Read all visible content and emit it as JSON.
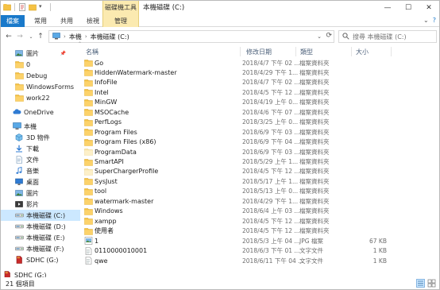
{
  "titlebar": {
    "context_tab": "磁碟機工具",
    "title": "本機磁碟 (C:)",
    "minimize": "—",
    "maximize": "☐",
    "close": "✕"
  },
  "ribbon": {
    "tabs": [
      "檔案",
      "常用",
      "共用",
      "檢視",
      "管理"
    ],
    "collapse": "⌄",
    "help": "?"
  },
  "address": {
    "crumbs": [
      "本機",
      "本機磁碟 (C:)"
    ],
    "search_placeholder": "搜尋 本機磁碟 (C:)"
  },
  "sidebar": {
    "items": [
      {
        "label": "圖片",
        "icon": "pictures-icon"
      },
      {
        "label": "0",
        "icon": "folder-icon"
      },
      {
        "label": "Debug",
        "icon": "folder-icon"
      },
      {
        "label": "WindowsForms",
        "icon": "folder-icon"
      },
      {
        "label": "work22",
        "icon": "folder-icon"
      },
      {
        "label": "OneDrive",
        "icon": "onedrive-icon"
      },
      {
        "label": "本機",
        "icon": "this-pc-icon"
      },
      {
        "label": "3D 物件",
        "icon": "3d-objects-icon"
      },
      {
        "label": "下載",
        "icon": "downloads-icon"
      },
      {
        "label": "文件",
        "icon": "documents-icon"
      },
      {
        "label": "音樂",
        "icon": "music-icon"
      },
      {
        "label": "桌面",
        "icon": "desktop-icon"
      },
      {
        "label": "圖片",
        "icon": "pictures-icon"
      },
      {
        "label": "影片",
        "icon": "videos-icon"
      },
      {
        "label": "本機磁碟 (C:)",
        "icon": "drive-icon"
      },
      {
        "label": "本機磁碟 (D:)",
        "icon": "drive-icon"
      },
      {
        "label": "本機磁碟 (E:)",
        "icon": "drive-icon"
      },
      {
        "label": "本機磁碟 (F:)",
        "icon": "drive-icon"
      },
      {
        "label": "SDHC (G:)",
        "icon": "sd-card-icon"
      },
      {
        "label": "SDHC (G:)",
        "icon": "sd-card-icon"
      }
    ]
  },
  "columns": {
    "name": "名稱",
    "date": "修改日期",
    "type": "類型",
    "size": "大小"
  },
  "files": [
    {
      "name": "Go",
      "date": "2018/4/7 下午 02 ...",
      "type": "檔案資料夾",
      "size": "",
      "kind": "folder"
    },
    {
      "name": "HiddenWatermark-master",
      "date": "2018/4/29 下午 1...",
      "type": "檔案資料夾",
      "size": "",
      "kind": "folder"
    },
    {
      "name": "InfoFile",
      "date": "2018/4/7 下午 02 ...",
      "type": "檔案資料夾",
      "size": "",
      "kind": "folder"
    },
    {
      "name": "Intel",
      "date": "2018/4/5 下午 12 ...",
      "type": "檔案資料夾",
      "size": "",
      "kind": "folder"
    },
    {
      "name": "MinGW",
      "date": "2018/4/19 上午 0...",
      "type": "檔案資料夾",
      "size": "",
      "kind": "folder"
    },
    {
      "name": "MSOCache",
      "date": "2018/4/6 下午 07 ...",
      "type": "檔案資料夾",
      "size": "",
      "kind": "folder"
    },
    {
      "name": "PerfLogs",
      "date": "2018/3/25 上午 0...",
      "type": "檔案資料夾",
      "size": "",
      "kind": "folder"
    },
    {
      "name": "Program Files",
      "date": "2018/6/9 下午 03 ...",
      "type": "檔案資料夾",
      "size": "",
      "kind": "folder"
    },
    {
      "name": "Program Files (x86)",
      "date": "2018/6/9 下午 04 ...",
      "type": "檔案資料夾",
      "size": "",
      "kind": "folder"
    },
    {
      "name": "ProgramData",
      "date": "2018/6/9 下午 03 ...",
      "type": "檔案資料夾",
      "size": "",
      "kind": "folder-light"
    },
    {
      "name": "SmartAPI",
      "date": "2018/5/29 上午 1...",
      "type": "檔案資料夾",
      "size": "",
      "kind": "folder"
    },
    {
      "name": "SuperChargerProfile",
      "date": "2018/4/5 下午 12 ...",
      "type": "檔案資料夾",
      "size": "",
      "kind": "folder-light"
    },
    {
      "name": "SysJust",
      "date": "2018/5/17 上午 1...",
      "type": "檔案資料夾",
      "size": "",
      "kind": "folder"
    },
    {
      "name": "tool",
      "date": "2018/5/13 上午 0...",
      "type": "檔案資料夾",
      "size": "",
      "kind": "folder"
    },
    {
      "name": "watermark-master",
      "date": "2018/4/29 下午 1...",
      "type": "檔案資料夾",
      "size": "",
      "kind": "folder"
    },
    {
      "name": "Windows",
      "date": "2018/6/4 上午 03 ...",
      "type": "檔案資料夾",
      "size": "",
      "kind": "folder"
    },
    {
      "name": "xampp",
      "date": "2018/4/5 下午 12 ...",
      "type": "檔案資料夾",
      "size": "",
      "kind": "folder"
    },
    {
      "name": "使用者",
      "date": "2018/4/5 下午 12 ...",
      "type": "檔案資料夾",
      "size": "",
      "kind": "folder"
    },
    {
      "name": "1",
      "date": "2018/5/3 上午 04 ...",
      "type": "JPG 檔案",
      "size": "67 KB",
      "kind": "image"
    },
    {
      "name": "0110000010001",
      "date": "2018/6/3 下午 01 ...",
      "type": "文字文件",
      "size": "1 KB",
      "kind": "text"
    },
    {
      "name": "qwe",
      "date": "2018/6/11 下午 04 ...",
      "type": "文字文件",
      "size": "1 KB",
      "kind": "text"
    }
  ],
  "status": {
    "count": "21 個項目"
  },
  "colors": {
    "accent": "#1979ca",
    "selection": "#cce8ff",
    "folder": "#f5c244",
    "context_tab": "#fbeab0"
  }
}
